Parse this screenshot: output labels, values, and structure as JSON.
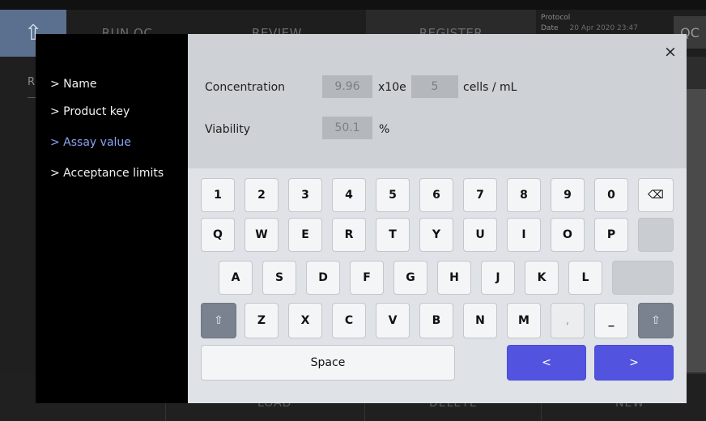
{
  "topbar": {
    "home_icon": "home-up-arrow-icon",
    "tabs": [
      "RUN QC",
      "REVIEW",
      "REGISTER"
    ],
    "protocol_label": "Protocol",
    "date_label": "Date",
    "date_value": "20 Apr 2020 23:47",
    "qc_label": "QC"
  },
  "background": {
    "left_letter": "R"
  },
  "bottombar": {
    "buttons": [
      "LOAD",
      "DELETE",
      "NEW"
    ]
  },
  "menu": {
    "items": [
      {
        "label": "> Name",
        "active": false
      },
      {
        "label": "> Product key",
        "active": false
      },
      {
        "label": "> Assay value",
        "active": true
      },
      {
        "label": "> Acceptance limits",
        "active": false
      }
    ]
  },
  "dialog": {
    "close_label": "×",
    "concentration": {
      "label": "Concentration",
      "value": "9.96",
      "multiplier": "x10e",
      "exponent": "5",
      "unit": "cells / mL"
    },
    "viability": {
      "label": "Viability",
      "value": "50.1",
      "unit": "%"
    }
  },
  "keyboard": {
    "row1": [
      "1",
      "2",
      "3",
      "4",
      "5",
      "6",
      "7",
      "8",
      "9",
      "0"
    ],
    "backspace_label": "⌫",
    "row2": [
      "Q",
      "W",
      "E",
      "R",
      "T",
      "Y",
      "U",
      "I",
      "O",
      "P"
    ],
    "row3": [
      "A",
      "S",
      "D",
      "F",
      "G",
      "H",
      "J",
      "K",
      "L"
    ],
    "row4": [
      "Z",
      "X",
      "C",
      "V",
      "B",
      "N",
      "M",
      ",",
      "_"
    ],
    "shift_label": "⇧",
    "space_label": "Space",
    "prev_label": "<",
    "next_label": ">"
  },
  "colors": {
    "accent": "#5254E0",
    "active_menu": "#8AA4F3",
    "home_button": "#5B6F8F"
  }
}
